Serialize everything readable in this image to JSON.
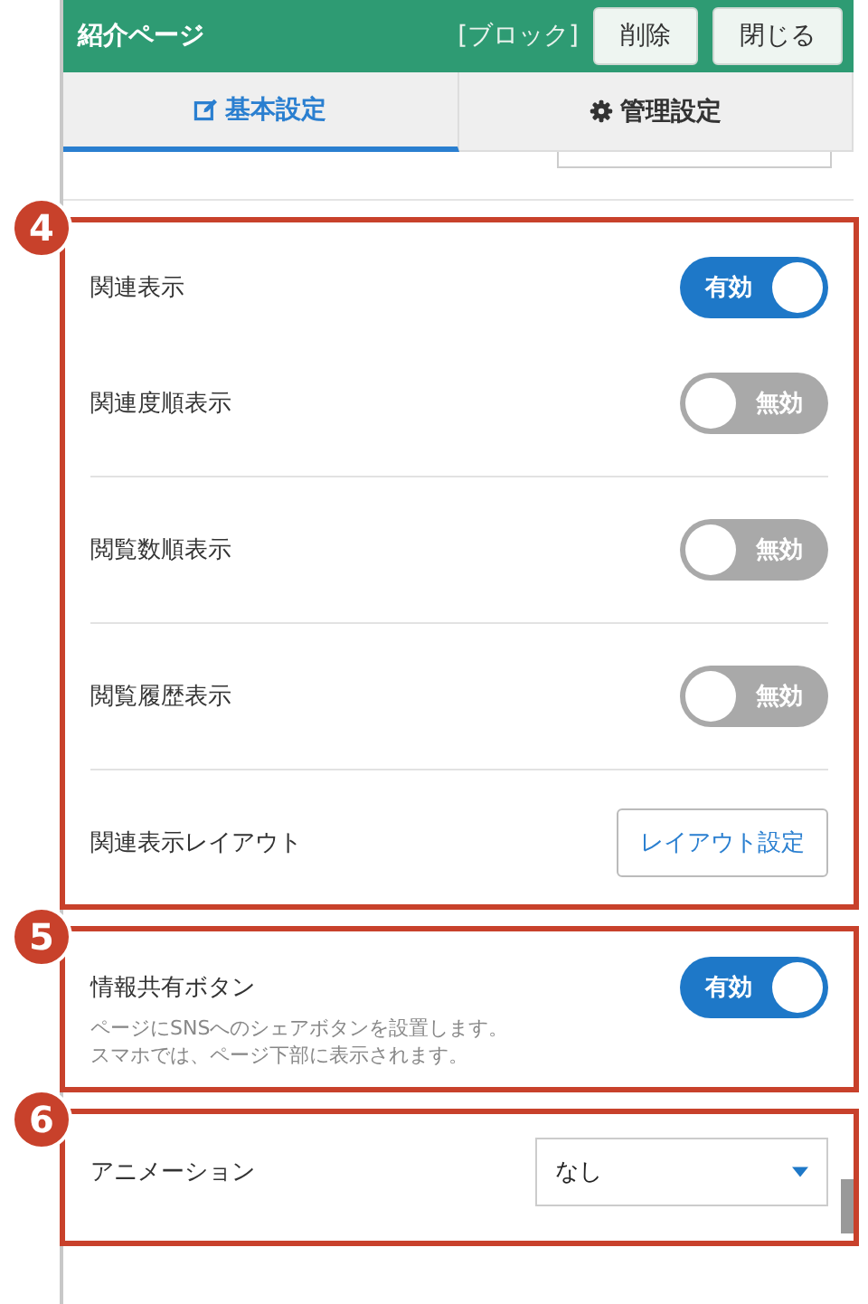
{
  "header": {
    "title": "紹介ページ",
    "type_label": "[ブロック]",
    "buttons": [
      "削除",
      "閉じる"
    ]
  },
  "tabs": [
    {
      "label": "基本設定",
      "selected": true
    },
    {
      "label": "管理設定",
      "selected": false
    }
  ],
  "sections": [
    {
      "badge": "4",
      "rows": [
        {
          "kind": "toggle",
          "label": "関連表示",
          "on": true,
          "state_text": "有効"
        },
        {
          "kind": "toggle",
          "label": "関連度順表示",
          "on": false,
          "state_text": "無効"
        },
        {
          "kind": "divider"
        },
        {
          "kind": "toggle",
          "label": "閲覧数順表示",
          "on": false,
          "state_text": "無効"
        },
        {
          "kind": "divider"
        },
        {
          "kind": "toggle",
          "label": "閲覧履歴表示",
          "on": false,
          "state_text": "無効"
        },
        {
          "kind": "divider"
        },
        {
          "kind": "button",
          "label": "関連表示レイアウト",
          "button": "レイアウト設定"
        }
      ]
    },
    {
      "badge": "5",
      "rows": [
        {
          "kind": "toggle",
          "label": "情報共有ボタン",
          "on": true,
          "state_text": "有効",
          "description": [
            "ページにSNSへのシェアボタンを設置します。",
            "スマホでは、ページ下部に表示されます。"
          ]
        }
      ]
    },
    {
      "badge": "6",
      "rows": [
        {
          "kind": "select",
          "label": "アニメーション",
          "value": "なし"
        }
      ]
    }
  ]
}
